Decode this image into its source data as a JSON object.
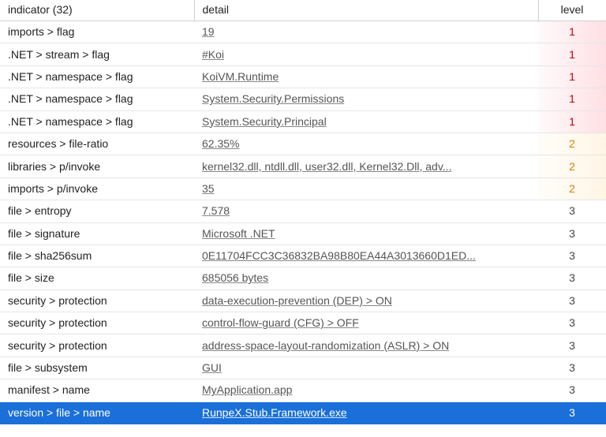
{
  "columns": {
    "indicator": "indicator (32)",
    "detail": "detail",
    "level": "level"
  },
  "rows": [
    {
      "indicator": "imports > flag",
      "detail": "19",
      "level": 1,
      "selected": false
    },
    {
      "indicator": ".NET > stream > flag",
      "detail": "#Koi",
      "level": 1,
      "selected": false
    },
    {
      "indicator": ".NET > namespace > flag",
      "detail": "KoiVM.Runtime",
      "level": 1,
      "selected": false
    },
    {
      "indicator": ".NET > namespace > flag",
      "detail": "System.Security.Permissions",
      "level": 1,
      "selected": false
    },
    {
      "indicator": ".NET > namespace > flag",
      "detail": "System.Security.Principal",
      "level": 1,
      "selected": false
    },
    {
      "indicator": "resources > file-ratio",
      "detail": "62.35%",
      "level": 2,
      "selected": false
    },
    {
      "indicator": "libraries > p/invoke",
      "detail": "kernel32.dll, ntdll.dll, user32.dll, Kernel32.Dll, adv...",
      "level": 2,
      "selected": false
    },
    {
      "indicator": "imports > p/invoke",
      "detail": "35",
      "level": 2,
      "selected": false
    },
    {
      "indicator": "file > entropy",
      "detail": "7.578",
      "level": 3,
      "selected": false
    },
    {
      "indicator": "file > signature",
      "detail": "Microsoft .NET",
      "level": 3,
      "selected": false
    },
    {
      "indicator": "file > sha256sum",
      "detail": "0E11704FCC3C36832BA98B80EA44A3013660D1ED...",
      "level": 3,
      "selected": false
    },
    {
      "indicator": "file > size",
      "detail": "685056 bytes",
      "level": 3,
      "selected": false
    },
    {
      "indicator": "security > protection",
      "detail": "data-execution-prevention (DEP) > ON",
      "level": 3,
      "selected": false
    },
    {
      "indicator": "security > protection",
      "detail": "control-flow-guard (CFG) > OFF",
      "level": 3,
      "selected": false
    },
    {
      "indicator": "security > protection",
      "detail": "address-space-layout-randomization (ASLR) > ON",
      "level": 3,
      "selected": false
    },
    {
      "indicator": "file > subsystem",
      "detail": "GUI",
      "level": 3,
      "selected": false
    },
    {
      "indicator": "manifest > name",
      "detail": "MyApplication.app",
      "level": 3,
      "selected": false
    },
    {
      "indicator": "version > file > name",
      "detail": "RunpeX.Stub.Framework.exe",
      "level": 3,
      "selected": true
    }
  ]
}
